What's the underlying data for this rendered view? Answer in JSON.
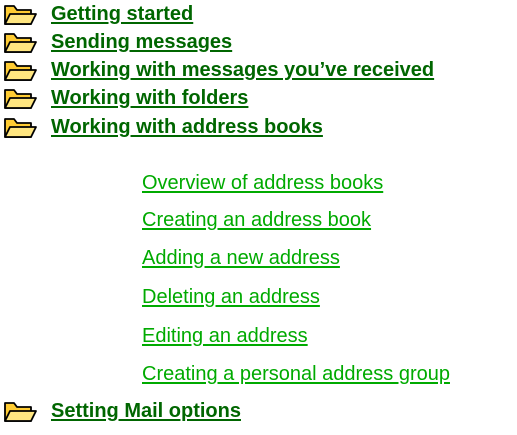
{
  "topics": [
    {
      "label": "Getting started",
      "icon": "open-folder-icon"
    },
    {
      "label": "Sending messages",
      "icon": "open-folder-icon"
    },
    {
      "label": "Working with messages you’ve received",
      "icon": "open-folder-icon"
    },
    {
      "label": "Working with folders",
      "icon": "open-folder-icon"
    },
    {
      "label": "Working with address books",
      "icon": "open-folder-icon"
    },
    {
      "label": "Setting Mail options",
      "icon": "open-folder-icon"
    }
  ],
  "address_book_subtopics": [
    "Overview of address books",
    "Creating an address book",
    "Adding a new address",
    "Deleting an address",
    "Editing an address",
    "Creating a personal address group"
  ],
  "colors": {
    "topic_link": "#006600",
    "subtopic_link": "#00aa00",
    "folder_fill": "#ffcc33",
    "folder_outline": "#000000"
  }
}
